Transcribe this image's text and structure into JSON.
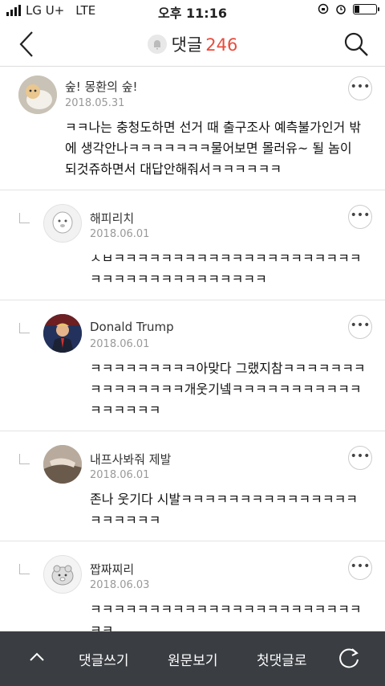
{
  "status_bar": {
    "carrier": "LG U+",
    "network": "LTE",
    "time": "오후 11:16"
  },
  "header": {
    "title": "댓글",
    "count": "246"
  },
  "comments": [
    {
      "author": "숲! 몽환의 숲!",
      "date": "2018.05.31",
      "text": "ㅋㅋ나는 충청도하면 선거 때 출구조사 예측불가인거 밖에 생각안나ㅋㅋㅋㅋㅋㅋㅋ물어보면 몰러유~ 될 놈이 되것쥬하면서 대답안해줘서ㅋㅋㅋㅋㅋㅋ"
    },
    {
      "author": "해피리치",
      "date": "2018.06.01",
      "text": "ㅅㅂㅋㅋㅋㅋㅋㅋㅋㅋㅋㅋㅋㅋㅋㅋㅋㅋㅋㅋㅋㅋㅋㅋㅋㅋㅋㅋㅋㅋㅋㅋㅋㅋㅋㅋㅋㅋ"
    },
    {
      "author": "Donald Trump",
      "date": "2018.06.01",
      "text": "ㅋㅋㅋㅋㅋㅋㅋㅋㅋ아맞다 그랬지참ㅋㅋㅋㅋㅋㅋㅋㅋㅋㅋㅋㅋㅋㅋㅋ개웃기넼ㅋㅋㅋㅋㅋㅋㅋㅋㅋㅋㅋㅋㅋㅋㅋㅋㅋ"
    },
    {
      "author": "내프사봐줘 제발",
      "date": "2018.06.01",
      "text": "존나 웃기다 시발ㅋㅋㅋㅋㅋㅋㅋㅋㅋㅋㅋㅋㅋㅋㅋㅋㅋㅋㅋㅋㅋ"
    },
    {
      "author": "짭짜찌리",
      "date": "2018.06.03",
      "text": "ㅋㅋㅋㅋㅋㅋㅋㅋㅋㅋㅋㅋㅋㅋㅋㅋㅋㅋㅋㅋㅋㅋㅋㅋㅋ"
    }
  ],
  "bottom_bar": {
    "write": "댓글쓰기",
    "original": "원문보기",
    "first": "첫댓글로"
  },
  "icons": {
    "back": "chevron-left-icon",
    "search": "search-icon",
    "more": "more-horizontal-icon",
    "up": "chevron-up-icon",
    "refresh": "refresh-icon"
  },
  "colors": {
    "count": "#e84c3d",
    "bottom_bar": "#3a3d42"
  }
}
